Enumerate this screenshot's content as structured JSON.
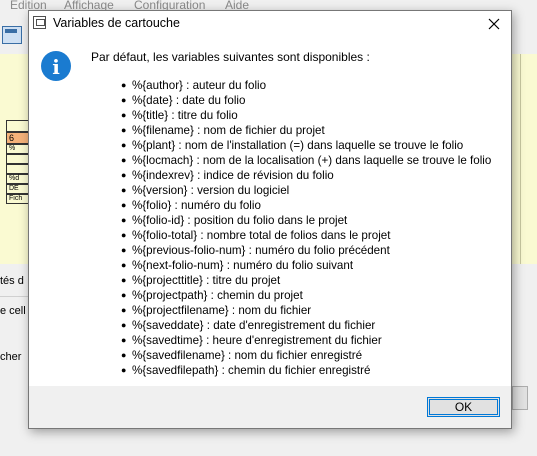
{
  "background_app": {
    "menu": [
      "Édition",
      "Affichage",
      "Configuration",
      "Aide"
    ],
    "frame_cells": [
      "6",
      "%",
      "%d",
      "DE",
      "Fich"
    ],
    "labels": [
      "tés d",
      "e cell",
      "cher"
    ]
  },
  "dialog": {
    "title": "Variables de cartouche",
    "intro": "Par défaut, les variables suivantes sont disponibles :",
    "variables": [
      "%{author} : auteur du folio",
      "%{date} : date du folio",
      "%{title} : titre du folio",
      "%{filename} : nom de fichier du projet",
      "%{plant} : nom de l'installation (=) dans laquelle se trouve le folio",
      "%{locmach} : nom de la localisation (+) dans laquelle se trouve le folio",
      "%{indexrev} : indice de révision du folio",
      "%{version} : version du logiciel",
      "%{folio} : numéro du folio",
      "%{folio-id} : position du folio dans le projet",
      "%{folio-total} : nombre total de folios dans le projet",
      "%{previous-folio-num} : numéro du folio précédent",
      "%{next-folio-num} : numéro du folio suivant",
      "%{projecttitle} : titre du projet",
      "%{projectpath} : chemin du projet",
      "%{projectfilename} : nom du fichier",
      "%{saveddate} : date d'enregistrement du fichier",
      "%{savedtime} : heure d'enregistrement du fichier",
      "%{savedfilename} : nom du fichier enregistré",
      "%{savedfilepath} : chemin du fichier enregistré"
    ],
    "ok_label": "OK"
  },
  "icons": {
    "info": "information-icon",
    "close": "close-icon",
    "app": "window-app-icon"
  },
  "colors": {
    "info_blue": "#1a7bd0",
    "button_focus": "#0078d7",
    "canvas_yellow": "#fafad2"
  }
}
